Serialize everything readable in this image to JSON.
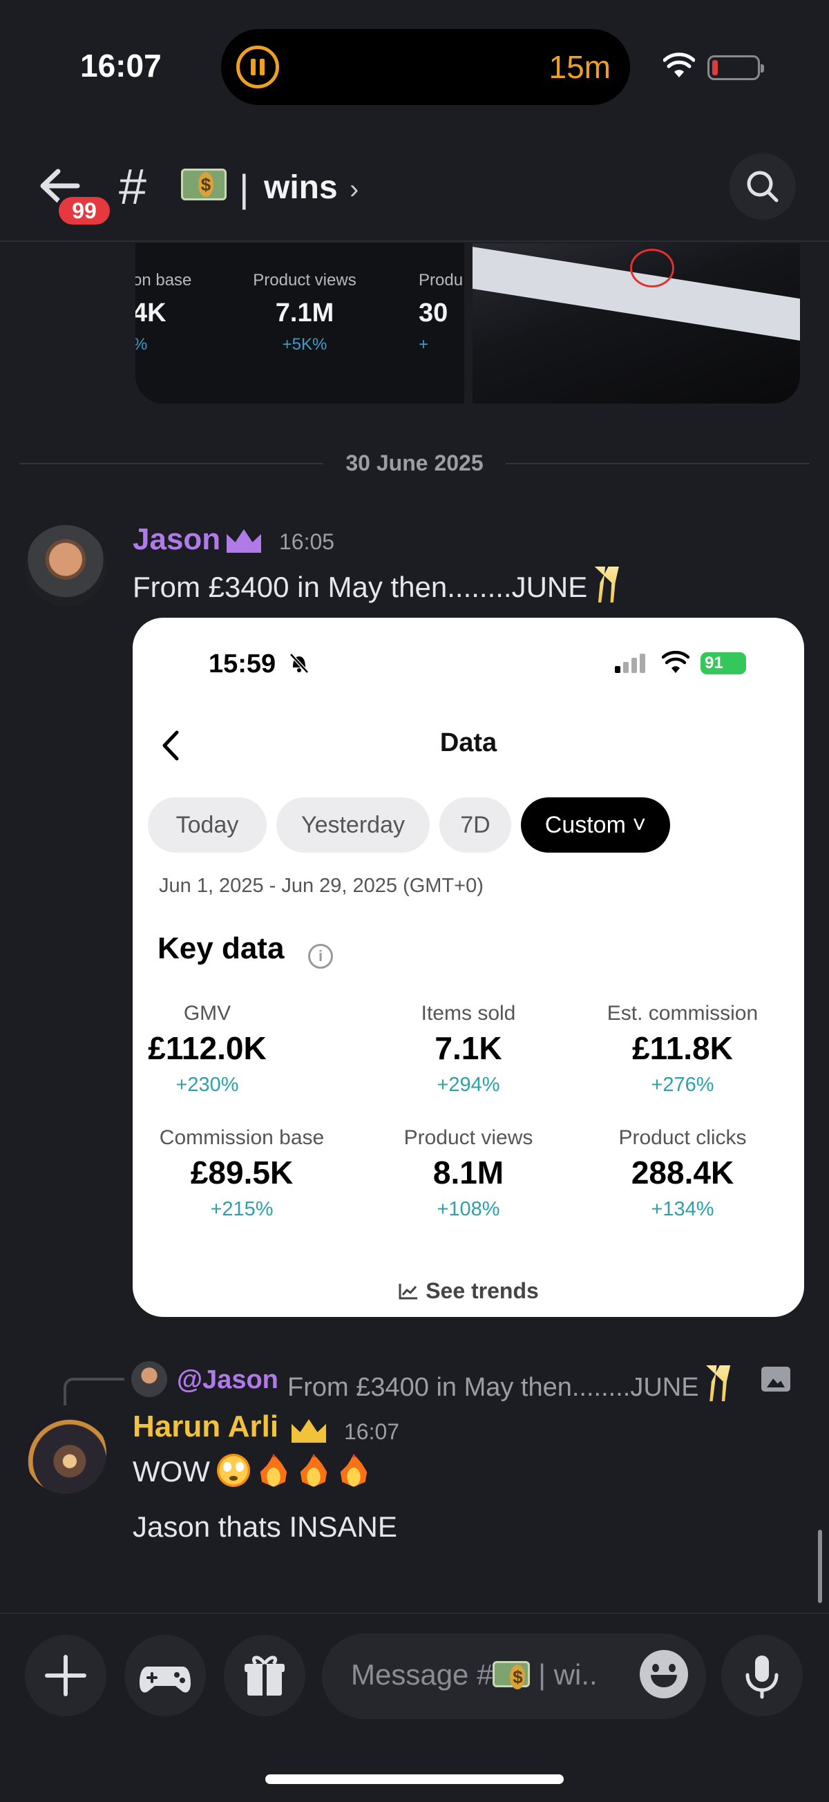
{
  "status_bar": {
    "time": "16:07",
    "timer": "15m",
    "battery_level_pct": 8
  },
  "header": {
    "badge_count": "99",
    "channel_prefix": "#",
    "channel_separator": "|",
    "channel_name": "wins",
    "chevron": "›"
  },
  "previous_embed": {
    "stats": [
      {
        "label": "on base",
        "value": "4K",
        "change": "%"
      },
      {
        "label": "Product views",
        "value": "7.1M",
        "change": "+5K%"
      },
      {
        "label": "Produ",
        "value": "30",
        "change": "+"
      }
    ]
  },
  "divider": {
    "date": "30 June 2025"
  },
  "message_jason": {
    "author": "Jason",
    "author_color": "#b07ae8",
    "time": "16:05",
    "text": "From £3400 in May then........JUNE"
  },
  "embed": {
    "clock": "15:59",
    "battery": "91",
    "title": "Data",
    "chips": [
      "Today",
      "Yesterday",
      "7D",
      "Custom ˅"
    ],
    "date_range": "Jun 1, 2025 - Jun 29, 2025 (GMT+0)",
    "section_title": "Key data",
    "info_icon": "i",
    "stats": [
      {
        "label": "GMV",
        "value": "£112.0K",
        "change": "+230%"
      },
      {
        "label": "Items sold",
        "value": "7.1K",
        "change": "+294%"
      },
      {
        "label": "Est. commission",
        "value": "£11.8K",
        "change": "+276%"
      },
      {
        "label": "Commission base",
        "value": "£89.5K",
        "change": "+215%"
      },
      {
        "label": "Product views",
        "value": "8.1M",
        "change": "+108%"
      },
      {
        "label": "Product clicks",
        "value": "288.4K",
        "change": "+134%"
      }
    ],
    "trends_label": "See trends"
  },
  "reply": {
    "mention": "@Jason",
    "text": "From £3400 in May then........JUNE"
  },
  "message_harun": {
    "author": "Harun Arli",
    "author_color": "#f2c23b",
    "time": "16:07",
    "line1": "WOW",
    "line2": "Jason thats INSANE"
  },
  "composer": {
    "placeholder_prefix": "Message #",
    "placeholder_suffix": "| wi.."
  },
  "icons": {
    "back": "arrow-left-icon",
    "search": "search-icon",
    "plus": "plus-icon",
    "games": "gamepad-icon",
    "gift": "gift-icon",
    "emoji": "smile-icon",
    "mic": "microphone-icon"
  }
}
